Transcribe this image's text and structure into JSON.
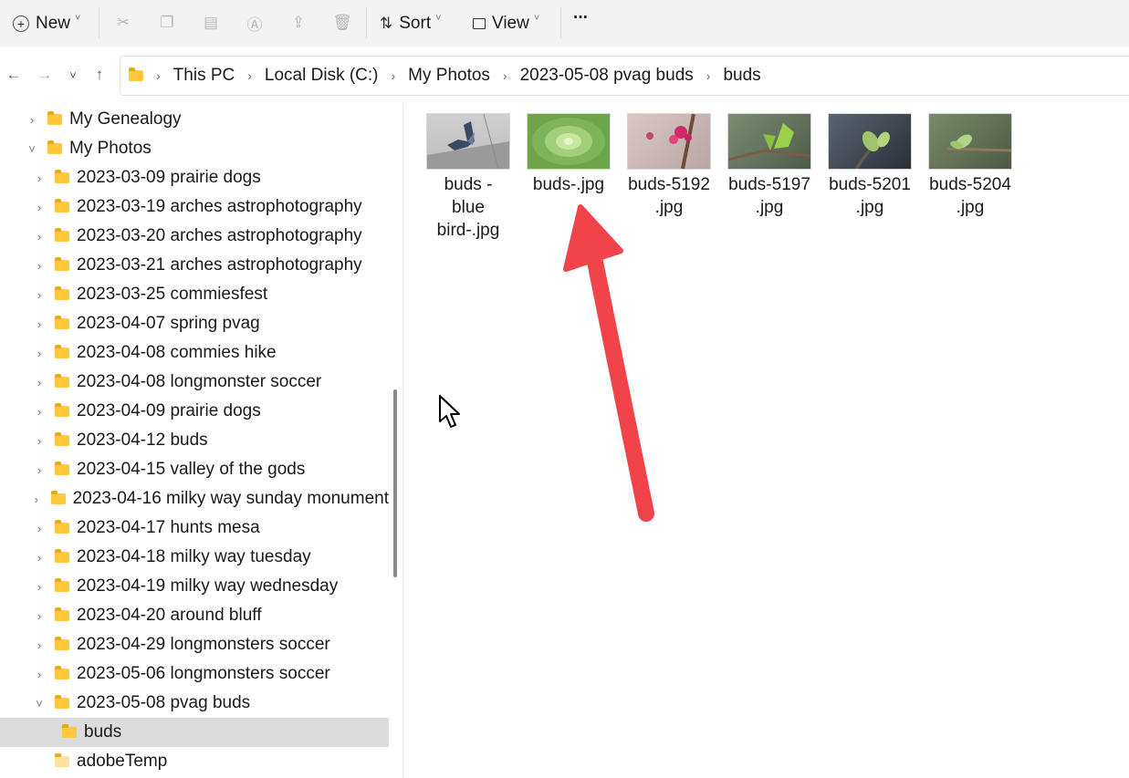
{
  "toolbar": {
    "new_label": "New",
    "sort_label": "Sort",
    "view_label": "View",
    "more_label": "···",
    "icons": [
      "cut-icon",
      "copy-icon",
      "paste-icon",
      "rename-icon",
      "share-icon",
      "delete-icon"
    ]
  },
  "address": {
    "crumbs": [
      "This PC",
      "Local Disk (C:)",
      "My Photos",
      "2023-05-08 pvag buds",
      "buds"
    ]
  },
  "sidebar": {
    "items": [
      {
        "label": "My Genealogy",
        "state": "collapsed"
      },
      {
        "label": "My Photos",
        "state": "expanded"
      },
      {
        "label": "2023-03-09 prairie dogs",
        "state": "collapsed"
      },
      {
        "label": "2023-03-19 arches astrophotography",
        "state": "collapsed"
      },
      {
        "label": "2023-03-20 arches astrophotography",
        "state": "collapsed"
      },
      {
        "label": "2023-03-21 arches astrophotography",
        "state": "collapsed"
      },
      {
        "label": "2023-03-25 commiesfest",
        "state": "collapsed"
      },
      {
        "label": "2023-04-07 spring pvag",
        "state": "collapsed"
      },
      {
        "label": "2023-04-08 commies hike",
        "state": "collapsed"
      },
      {
        "label": "2023-04-08 longmonster soccer",
        "state": "collapsed"
      },
      {
        "label": "2023-04-09 prairie dogs",
        "state": "collapsed"
      },
      {
        "label": "2023-04-12 buds",
        "state": "collapsed"
      },
      {
        "label": "2023-04-15 valley of the gods",
        "state": "collapsed"
      },
      {
        "label": "2023-04-16 milky way sunday monument",
        "state": "collapsed"
      },
      {
        "label": "2023-04-17 hunts mesa",
        "state": "collapsed"
      },
      {
        "label": "2023-04-18 milky way tuesday",
        "state": "collapsed"
      },
      {
        "label": "2023-04-19 milky way wednesday",
        "state": "collapsed"
      },
      {
        "label": "2023-04-20 around bluff",
        "state": "collapsed"
      },
      {
        "label": "2023-04-29 longmonsters soccer",
        "state": "collapsed"
      },
      {
        "label": "2023-05-06 longmonsters soccer",
        "state": "collapsed"
      },
      {
        "label": "2023-05-08 pvag buds",
        "state": "expanded"
      },
      {
        "label": "buds",
        "state": "selected"
      },
      {
        "label": "adobeTemp",
        "state": "none"
      }
    ]
  },
  "files": [
    {
      "line1": "buds -",
      "line2": "blue",
      "line3": "bird-.jpg",
      "thumb": "bird"
    },
    {
      "line1": "buds-.jpg",
      "line2": "",
      "line3": "",
      "thumb": "succulent"
    },
    {
      "line1": "buds-5192",
      "line2": ".jpg",
      "line3": "",
      "thumb": "pink-buds"
    },
    {
      "line1": "buds-5197",
      "line2": ".jpg",
      "line3": "",
      "thumb": "green-leaves"
    },
    {
      "line1": "buds-5201",
      "line2": ".jpg",
      "line3": "",
      "thumb": "bud-dark"
    },
    {
      "line1": "buds-5204",
      "line2": ".jpg",
      "line3": "",
      "thumb": "bud-branch"
    }
  ],
  "colors": {
    "folder": "#ffc83d",
    "selected": "#dcdcdc",
    "annotation_arrow": "#f0444a"
  }
}
